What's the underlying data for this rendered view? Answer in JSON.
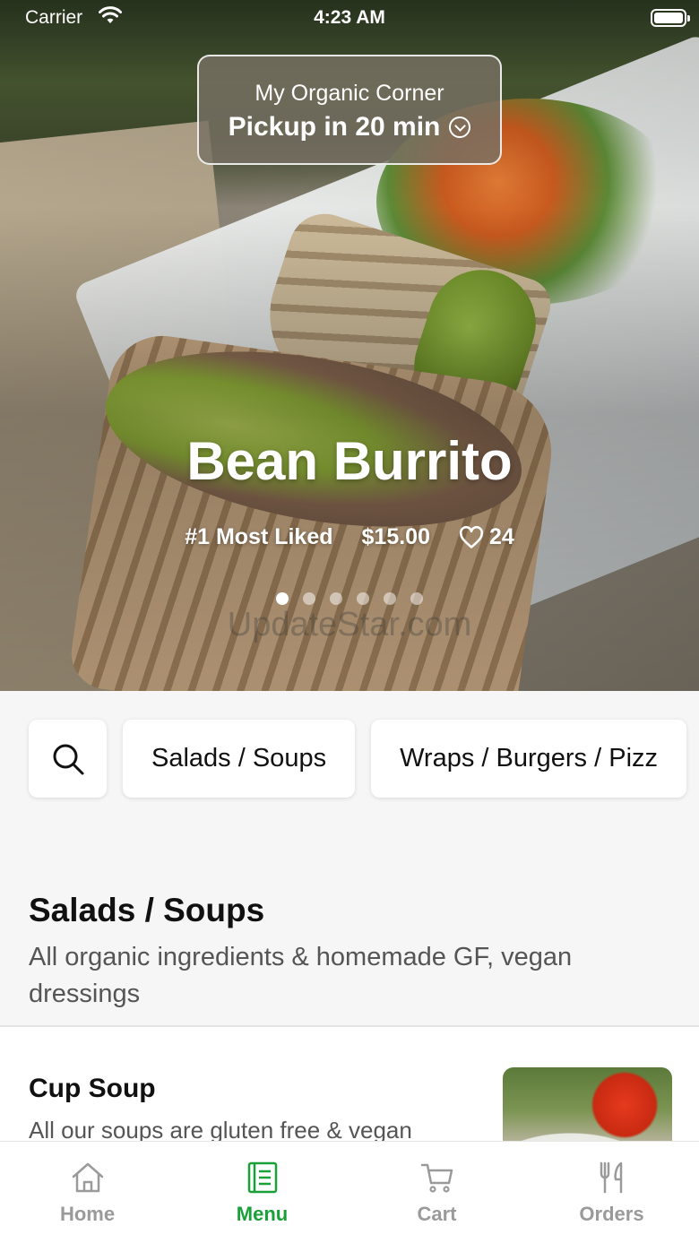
{
  "status_bar": {
    "carrier": "Carrier",
    "time": "4:23 AM"
  },
  "location": {
    "store_name": "My Organic Corner",
    "pickup": "Pickup in 20 min"
  },
  "featured": {
    "title": "Bean Burrito",
    "badge": "#1 Most Liked",
    "price": "$15.00",
    "likes": "24",
    "slide_count": 6,
    "active_slide": 1,
    "watermark": "UpdateStar.com"
  },
  "categories": {
    "search_icon": "search-icon",
    "items": [
      "Salads / Soups",
      "Wraps / Burgers / Pizz"
    ]
  },
  "section": {
    "title": "Salads / Soups",
    "description": "All organic ingredients & homemade GF, vegan dressings"
  },
  "menu_items": [
    {
      "name": "Cup Soup",
      "description": "All our soups are gluten free & vegan"
    }
  ],
  "tabs": [
    {
      "label": "Home",
      "icon": "home-icon",
      "active": false
    },
    {
      "label": "Menu",
      "icon": "menu-icon",
      "active": true
    },
    {
      "label": "Cart",
      "icon": "cart-icon",
      "active": false
    },
    {
      "label": "Orders",
      "icon": "orders-icon",
      "active": false
    }
  ],
  "colors": {
    "accent": "#1aa038",
    "tab_inactive": "#9a9a9a"
  }
}
